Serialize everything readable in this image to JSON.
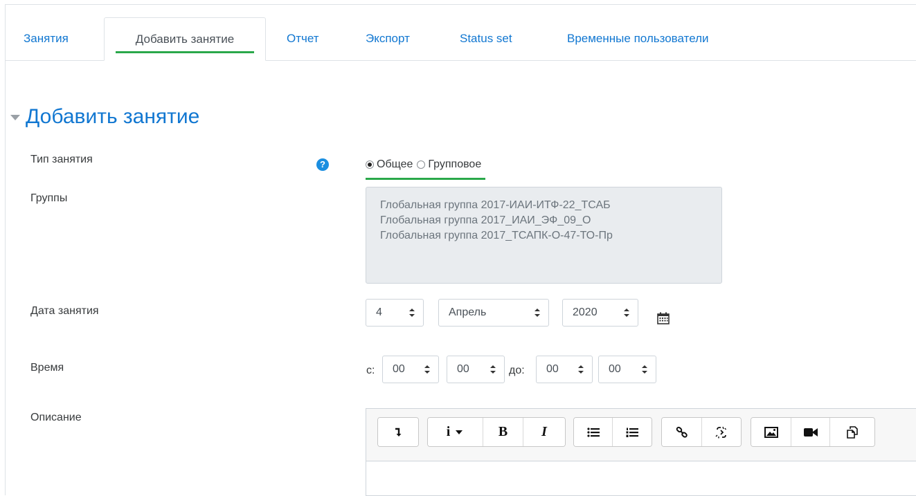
{
  "tabs": [
    {
      "label": "Занятия"
    },
    {
      "label": "Добавить занятие",
      "active": true
    },
    {
      "label": "Отчет"
    },
    {
      "label": "Экспорт"
    },
    {
      "label": "Status set"
    },
    {
      "label": "Временные пользователи"
    }
  ],
  "section": {
    "title": "Добавить занятие"
  },
  "form": {
    "type": {
      "label": "Тип занятия",
      "help_icon": "question-circle-icon",
      "options": [
        {
          "label": "Общее",
          "checked": true
        },
        {
          "label": "Групповое",
          "checked": false
        }
      ]
    },
    "groups": {
      "label": "Группы",
      "items": [
        "Глобальная группа 2017-ИАИ-ИТФ-22_ТСАБ",
        "Глобальная группа 2017_ИАИ_ЭФ_09_О",
        "Глобальная группа 2017_ТСАПК-О-47-ТО-Пр"
      ]
    },
    "date": {
      "label": "Дата занятия",
      "day": "4",
      "month": "Апрель",
      "year": "2020",
      "calendar_icon": "calendar-icon"
    },
    "time": {
      "label": "Время",
      "from_label": "с:",
      "to_label": "до:",
      "from_hour": "00",
      "from_minute": "00",
      "to_hour": "00",
      "to_minute": "00"
    },
    "description": {
      "label": "Описание",
      "toolbar_icons": [
        "collapse-toolbar-icon",
        "paragraph-styles-icon",
        "bold-icon",
        "italic-icon",
        "unordered-list-icon",
        "ordered-list-icon",
        "link-icon",
        "unlink-icon",
        "image-icon",
        "video-icon",
        "manage-files-icon"
      ],
      "bold_glyph": "B",
      "italic_glyph": "I",
      "info_glyph": "i"
    }
  },
  "colors": {
    "link": "#1177d1",
    "active_underline": "#2aa84a",
    "help": "#1a8ee0"
  }
}
